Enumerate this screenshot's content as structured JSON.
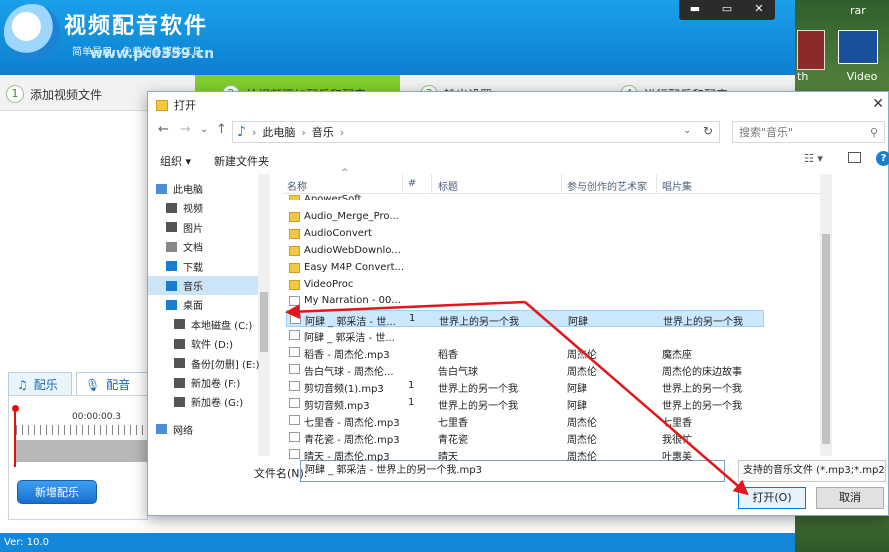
{
  "app": {
    "title": "视频配音软件",
    "slogan": "简单易用、免费的多媒体工具",
    "watermark": "www.pc0359.cn",
    "window_controls": [
      "▬",
      "▭",
      "✕"
    ],
    "steps": [
      {
        "num": "1",
        "label": "添加视频文件"
      },
      {
        "num": "2",
        "label": "给视频添加配乐和配音"
      },
      {
        "num": "3",
        "label": "输出设置"
      },
      {
        "num": "4",
        "label": "进行配乐和配音"
      }
    ],
    "tabs": {
      "music": "配乐",
      "voice": "配音"
    },
    "timeline_time": "00:00:00.3",
    "add_audio_button": "新增配乐",
    "version": "Ver: 10.0",
    "right_panel": {
      "rar": "rar",
      "video_label": "Video",
      "th": "th"
    }
  },
  "dialog": {
    "title": "打开",
    "close": "✕",
    "nav": {
      "back": "←",
      "forward": "→",
      "dropdown": "⌄",
      "up": "↑"
    },
    "breadcrumb": [
      "此电脑",
      "音乐"
    ],
    "search_placeholder": "搜索\"音乐\"",
    "toolbar": {
      "organize": "组织 ▾",
      "new_folder": "新建文件夹",
      "view": "☷ ▾",
      "help": "?"
    },
    "nav_pane": [
      {
        "label": "此电脑",
        "icon": "computer-icon",
        "color": "#4a8fd6"
      },
      {
        "label": "视频",
        "icon": "video-folder-icon",
        "color": "#555"
      },
      {
        "label": "图片",
        "icon": "picture-folder-icon",
        "color": "#555"
      },
      {
        "label": "文档",
        "icon": "document-folder-icon",
        "color": "#888"
      },
      {
        "label": "下载",
        "icon": "download-icon",
        "color": "#1a7dd4"
      },
      {
        "label": "音乐",
        "icon": "music-icon",
        "color": "#1a7dd4"
      },
      {
        "label": "桌面",
        "icon": "desktop-icon",
        "color": "#1a7dd4"
      },
      {
        "label": "本地磁盘 (C:)",
        "icon": "drive-icon",
        "color": "#555"
      },
      {
        "label": "软件 (D:)",
        "icon": "drive-icon",
        "color": "#555"
      },
      {
        "label": "备份[勿删] (E:)",
        "icon": "drive-icon",
        "color": "#555"
      },
      {
        "label": "新加卷 (F:)",
        "icon": "drive-icon",
        "color": "#555"
      },
      {
        "label": "新加卷 (G:)",
        "icon": "drive-icon",
        "color": "#555"
      },
      {
        "label": "网络",
        "icon": "network-icon",
        "color": "#4a8fd6"
      }
    ],
    "selected_nav": 5,
    "columns": [
      "名称",
      "#",
      "标题",
      "参与创作的艺术家",
      "唱片集"
    ],
    "files": [
      {
        "name": "ApowerSoft",
        "type": "folder",
        "num": "",
        "title": "",
        "artist": "",
        "album": ""
      },
      {
        "name": "Audio_Merge_Pro...",
        "type": "folder",
        "num": "",
        "title": "",
        "artist": "",
        "album": ""
      },
      {
        "name": "AudioConvert",
        "type": "folder",
        "num": "",
        "title": "",
        "artist": "",
        "album": ""
      },
      {
        "name": "AudioWebDownlo...",
        "type": "folder",
        "num": "",
        "title": "",
        "artist": "",
        "album": ""
      },
      {
        "name": "Easy M4P Convert...",
        "type": "folder",
        "num": "",
        "title": "",
        "artist": "",
        "album": ""
      },
      {
        "name": "VideoProc",
        "type": "folder",
        "num": "",
        "title": "",
        "artist": "",
        "album": ""
      },
      {
        "name": "My Narration - 00...",
        "type": "mp3",
        "num": "",
        "title": "",
        "artist": "",
        "album": ""
      },
      {
        "name": "阿肆 _ 郭采洁 - 世...",
        "type": "mp3",
        "num": "1",
        "title": "世界上的另一个我",
        "artist": "阿肆",
        "album": "世界上的另一个我"
      },
      {
        "name": "阿肆 _ 郭采洁 - 世...",
        "type": "mp3",
        "num": "",
        "title": "",
        "artist": "",
        "album": ""
      },
      {
        "name": "稻香 - 周杰伦.mp3",
        "type": "mp3",
        "num": "",
        "title": "稻香",
        "artist": "周杰伦",
        "album": "魔杰座"
      },
      {
        "name": "告白气球 - 周杰伦...",
        "type": "mp3",
        "num": "",
        "title": "告白气球",
        "artist": "周杰伦",
        "album": "周杰伦的床边故事"
      },
      {
        "name": "剪切音频(1).mp3",
        "type": "mp3",
        "num": "1",
        "title": "世界上的另一个我",
        "artist": "阿肆",
        "album": "世界上的另一个我"
      },
      {
        "name": "剪切音频.mp3",
        "type": "mp3",
        "num": "1",
        "title": "世界上的另一个我",
        "artist": "阿肆",
        "album": "世界上的另一个我"
      },
      {
        "name": "七里香 - 周杰伦.mp3",
        "type": "mp3",
        "num": "",
        "title": "七里香",
        "artist": "周杰伦",
        "album": "七里香"
      },
      {
        "name": "青花瓷 - 周杰伦.mp3",
        "type": "mp3",
        "num": "",
        "title": "青花瓷",
        "artist": "周杰伦",
        "album": "我很忙"
      },
      {
        "name": "晴天 - 周杰伦.mp3",
        "type": "mp3",
        "num": "",
        "title": "晴天",
        "artist": "周杰伦",
        "album": "叶惠美"
      }
    ],
    "selected_file": 7,
    "filename_label": "文件名(N):",
    "filename_value": "阿肆 _ 郭采洁 - 世界上的另一个我.mp3",
    "filter": "支持的音乐文件 (*.mp3;*.mp2",
    "open_button": "打开(O)",
    "cancel_button": "取消"
  },
  "colors": {
    "accent_blue": "#1686d9",
    "step_active": "#7fcf2e",
    "annotation_red": "#e3171b",
    "selection": "#cce8ff"
  }
}
